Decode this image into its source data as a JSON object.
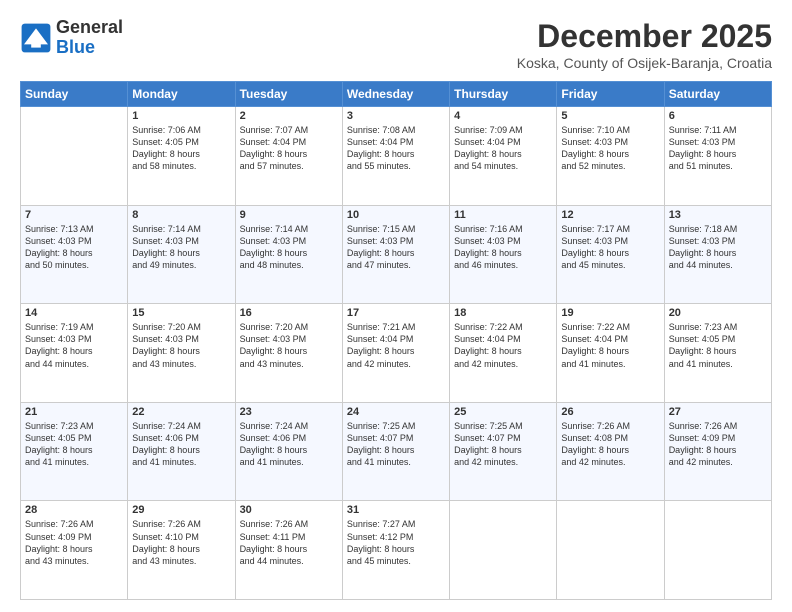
{
  "header": {
    "logo_line1": "General",
    "logo_line2": "Blue",
    "month_title": "December 2025",
    "location": "Koska, County of Osijek-Baranja, Croatia"
  },
  "days_of_week": [
    "Sunday",
    "Monday",
    "Tuesday",
    "Wednesday",
    "Thursday",
    "Friday",
    "Saturday"
  ],
  "weeks": [
    [
      {
        "day": "",
        "info": ""
      },
      {
        "day": "1",
        "info": "Sunrise: 7:06 AM\nSunset: 4:05 PM\nDaylight: 8 hours\nand 58 minutes."
      },
      {
        "day": "2",
        "info": "Sunrise: 7:07 AM\nSunset: 4:04 PM\nDaylight: 8 hours\nand 57 minutes."
      },
      {
        "day": "3",
        "info": "Sunrise: 7:08 AM\nSunset: 4:04 PM\nDaylight: 8 hours\nand 55 minutes."
      },
      {
        "day": "4",
        "info": "Sunrise: 7:09 AM\nSunset: 4:04 PM\nDaylight: 8 hours\nand 54 minutes."
      },
      {
        "day": "5",
        "info": "Sunrise: 7:10 AM\nSunset: 4:03 PM\nDaylight: 8 hours\nand 52 minutes."
      },
      {
        "day": "6",
        "info": "Sunrise: 7:11 AM\nSunset: 4:03 PM\nDaylight: 8 hours\nand 51 minutes."
      }
    ],
    [
      {
        "day": "7",
        "info": "Sunrise: 7:13 AM\nSunset: 4:03 PM\nDaylight: 8 hours\nand 50 minutes."
      },
      {
        "day": "8",
        "info": "Sunrise: 7:14 AM\nSunset: 4:03 PM\nDaylight: 8 hours\nand 49 minutes."
      },
      {
        "day": "9",
        "info": "Sunrise: 7:14 AM\nSunset: 4:03 PM\nDaylight: 8 hours\nand 48 minutes."
      },
      {
        "day": "10",
        "info": "Sunrise: 7:15 AM\nSunset: 4:03 PM\nDaylight: 8 hours\nand 47 minutes."
      },
      {
        "day": "11",
        "info": "Sunrise: 7:16 AM\nSunset: 4:03 PM\nDaylight: 8 hours\nand 46 minutes."
      },
      {
        "day": "12",
        "info": "Sunrise: 7:17 AM\nSunset: 4:03 PM\nDaylight: 8 hours\nand 45 minutes."
      },
      {
        "day": "13",
        "info": "Sunrise: 7:18 AM\nSunset: 4:03 PM\nDaylight: 8 hours\nand 44 minutes."
      }
    ],
    [
      {
        "day": "14",
        "info": "Sunrise: 7:19 AM\nSunset: 4:03 PM\nDaylight: 8 hours\nand 44 minutes."
      },
      {
        "day": "15",
        "info": "Sunrise: 7:20 AM\nSunset: 4:03 PM\nDaylight: 8 hours\nand 43 minutes."
      },
      {
        "day": "16",
        "info": "Sunrise: 7:20 AM\nSunset: 4:03 PM\nDaylight: 8 hours\nand 43 minutes."
      },
      {
        "day": "17",
        "info": "Sunrise: 7:21 AM\nSunset: 4:04 PM\nDaylight: 8 hours\nand 42 minutes."
      },
      {
        "day": "18",
        "info": "Sunrise: 7:22 AM\nSunset: 4:04 PM\nDaylight: 8 hours\nand 42 minutes."
      },
      {
        "day": "19",
        "info": "Sunrise: 7:22 AM\nSunset: 4:04 PM\nDaylight: 8 hours\nand 41 minutes."
      },
      {
        "day": "20",
        "info": "Sunrise: 7:23 AM\nSunset: 4:05 PM\nDaylight: 8 hours\nand 41 minutes."
      }
    ],
    [
      {
        "day": "21",
        "info": "Sunrise: 7:23 AM\nSunset: 4:05 PM\nDaylight: 8 hours\nand 41 minutes."
      },
      {
        "day": "22",
        "info": "Sunrise: 7:24 AM\nSunset: 4:06 PM\nDaylight: 8 hours\nand 41 minutes."
      },
      {
        "day": "23",
        "info": "Sunrise: 7:24 AM\nSunset: 4:06 PM\nDaylight: 8 hours\nand 41 minutes."
      },
      {
        "day": "24",
        "info": "Sunrise: 7:25 AM\nSunset: 4:07 PM\nDaylight: 8 hours\nand 41 minutes."
      },
      {
        "day": "25",
        "info": "Sunrise: 7:25 AM\nSunset: 4:07 PM\nDaylight: 8 hours\nand 42 minutes."
      },
      {
        "day": "26",
        "info": "Sunrise: 7:26 AM\nSunset: 4:08 PM\nDaylight: 8 hours\nand 42 minutes."
      },
      {
        "day": "27",
        "info": "Sunrise: 7:26 AM\nSunset: 4:09 PM\nDaylight: 8 hours\nand 42 minutes."
      }
    ],
    [
      {
        "day": "28",
        "info": "Sunrise: 7:26 AM\nSunset: 4:09 PM\nDaylight: 8 hours\nand 43 minutes."
      },
      {
        "day": "29",
        "info": "Sunrise: 7:26 AM\nSunset: 4:10 PM\nDaylight: 8 hours\nand 43 minutes."
      },
      {
        "day": "30",
        "info": "Sunrise: 7:26 AM\nSunset: 4:11 PM\nDaylight: 8 hours\nand 44 minutes."
      },
      {
        "day": "31",
        "info": "Sunrise: 7:27 AM\nSunset: 4:12 PM\nDaylight: 8 hours\nand 45 minutes."
      },
      {
        "day": "",
        "info": ""
      },
      {
        "day": "",
        "info": ""
      },
      {
        "day": "",
        "info": ""
      }
    ]
  ]
}
